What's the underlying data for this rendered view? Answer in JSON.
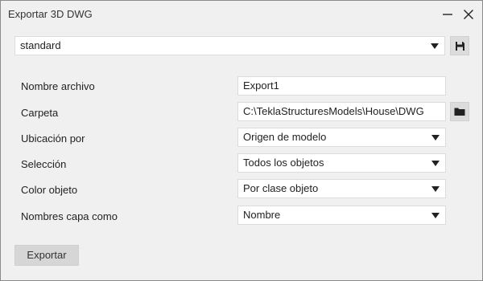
{
  "window": {
    "title": "Exportar 3D DWG"
  },
  "preset": {
    "value": "standard"
  },
  "fields": {
    "file_name": {
      "label": "Nombre archivo",
      "value": "Export1"
    },
    "folder": {
      "label": "Carpeta",
      "value": "C:\\TeklaStructuresModels\\House\\DWG"
    },
    "location_by": {
      "label": "Ubicación por",
      "value": "Origen de modelo"
    },
    "selection": {
      "label": "Selección",
      "value": "Todos los objetos"
    },
    "object_color": {
      "label": "Color objeto",
      "value": "Por clase objeto"
    },
    "layer_names": {
      "label": "Nombres capa como",
      "value": "Nombre"
    }
  },
  "actions": {
    "export_label": "Exportar"
  },
  "colors": {
    "window_bg": "#f0f0f0",
    "button_bg": "#d6d6d6",
    "field_bg": "#ffffff"
  },
  "icons": {
    "minimize": "minimize-icon",
    "close": "close-icon",
    "save": "save-icon",
    "folder": "folder-icon",
    "dropdown": "chevron-down-icon"
  }
}
